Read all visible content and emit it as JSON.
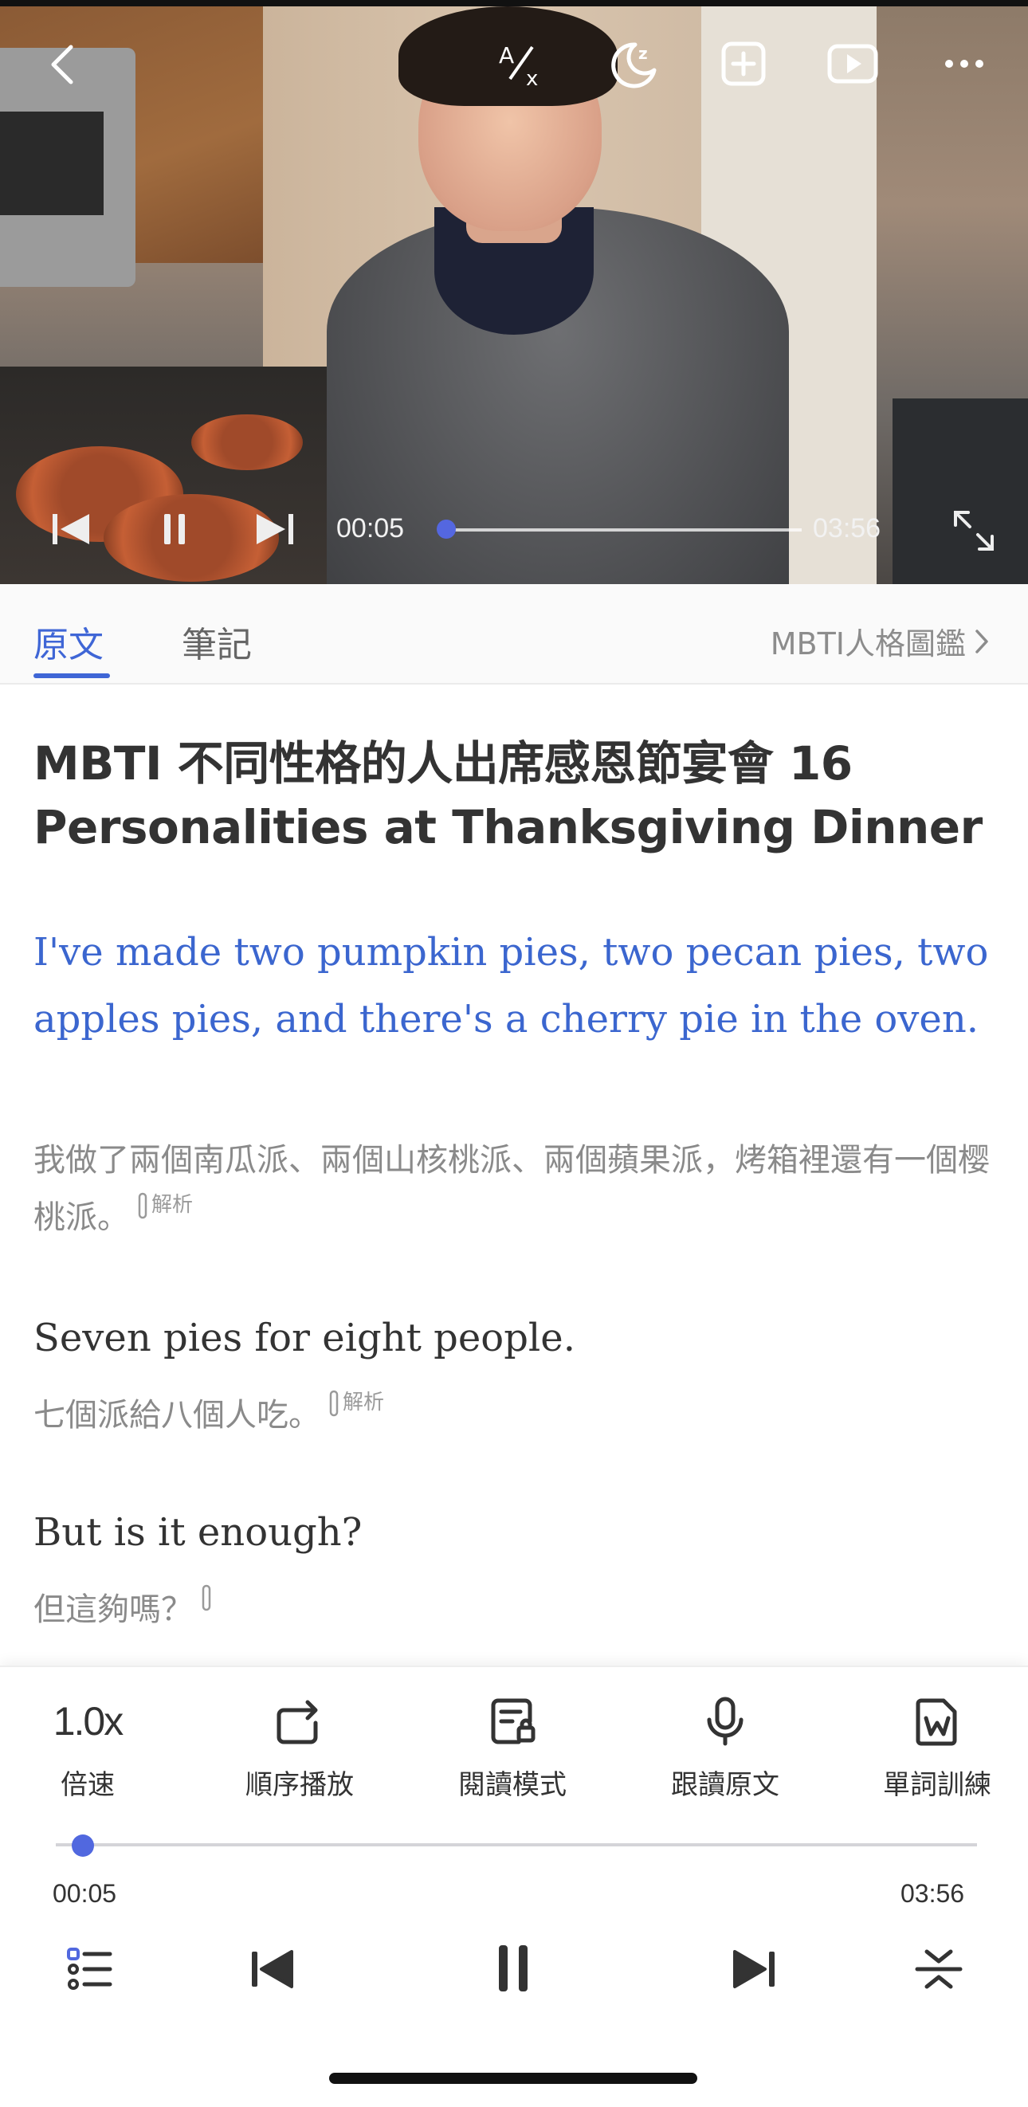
{
  "video": {
    "current_time": "00:05",
    "duration": "03:56",
    "progress": 0.021,
    "icons": [
      "back-icon",
      "translate-icon",
      "sleep-timer-icon",
      "add-icon",
      "video-icon",
      "more-icon",
      "previous-icon",
      "pause-icon",
      "next-icon",
      "fullscreen-icon"
    ]
  },
  "tabs": {
    "original": "原文",
    "notes": "筆記",
    "link": "MBTI人格圖鑑"
  },
  "article": {
    "title": "MBTI 不同性格的人出席感恩節宴會 16 Personalities at Thanksgiving Dinner",
    "sentences": [
      {
        "en": "I've made two pumpkin pies, two pecan pies, two apples pies, and there's a cherry pie in the oven.",
        "zh": "我做了兩個南瓜派、兩個山核桃派、兩個蘋果派，烤箱裡還有一個樱桃派。",
        "analysis": "解析"
      },
      {
        "en": "Seven pies for eight people.",
        "zh": "七個派給八個人吃。",
        "analysis": "解析"
      },
      {
        "en": "But is it enough?",
        "zh": "但這夠嗎？"
      }
    ]
  },
  "toolbar": {
    "speed_value": "1.0x",
    "speed_label": "倍速",
    "order_label": "順序播放",
    "reading_label": "閱讀模式",
    "shadow_label": "跟讀原文",
    "vocab_label": "單詞訓練"
  },
  "player": {
    "current_time": "00:05",
    "duration": "03:56",
    "progress": 0.021
  },
  "colors": {
    "accent": "#3f66d6",
    "slider": "#5168df"
  }
}
